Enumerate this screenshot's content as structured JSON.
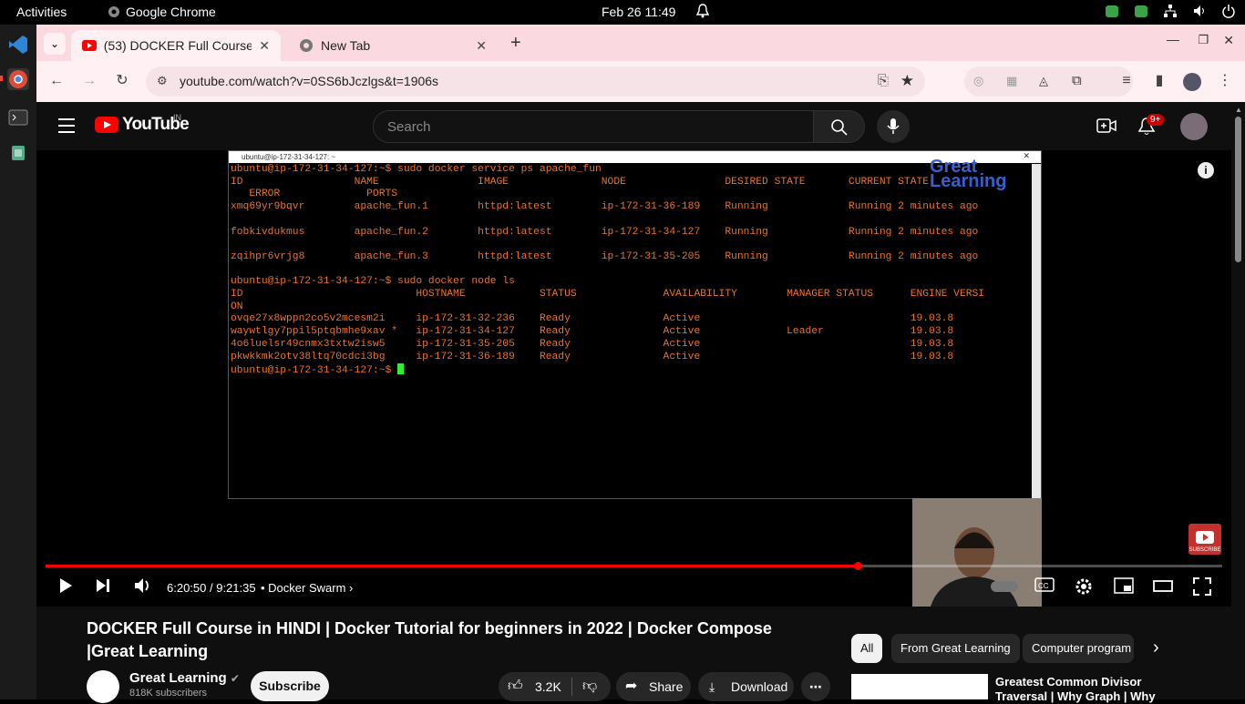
{
  "os": {
    "activities": "Activities",
    "app_name": "Google Chrome",
    "clock": "Feb 26  11:49"
  },
  "browser": {
    "tabs": [
      {
        "label": "(53) DOCKER Full Course",
        "active": true
      },
      {
        "label": "New Tab",
        "active": false
      }
    ],
    "url": "youtube.com/watch?v=0SS6bJczlgs&t=1906s"
  },
  "youtube": {
    "logo_text": "YouTube",
    "region": "IN",
    "search_placeholder": "Search",
    "notif_count": "9+"
  },
  "terminal": {
    "title": "ubuntu@ip-172-31-34-127: ~",
    "lines": [
      "ubuntu@ip-172-31-34-127:~$ sudo docker service ps apache_fun",
      "ID                  NAME                IMAGE               NODE                DESIRED STATE       CURRENT STATE",
      "   ERROR              PORTS",
      "xmq69yr9bqvr        apache_fun.1        httpd:latest        ip-172-31-36-189    Running             Running 2 minutes ago",
      "",
      "fobkivdukmus        apache_fun.2        httpd:latest        ip-172-31-34-127    Running             Running 2 minutes ago",
      "",
      "zqihpr6vrjg8        apache_fun.3        httpd:latest        ip-172-31-35-205    Running             Running 2 minutes ago",
      "",
      "ubuntu@ip-172-31-34-127:~$ sudo docker node ls",
      "ID                            HOSTNAME            STATUS              AVAILABILITY        MANAGER STATUS      ENGINE VERSI",
      "ON",
      "ovqe27x8wppn2co5v2mcesm2i     ip-172-31-32-236    Ready               Active                                  19.03.8",
      "waywtlgy7ppil5ptqbmhe9xav *   ip-172-31-34-127    Ready               Active              Leader              19.03.8",
      "4o6luelsr49cnmx3txtw2isw5     ip-172-31-35-205    Ready               Active                                  19.03.8",
      "pkwkkmk2otv38ltq70cdci3bg     ip-172-31-36-189    Ready               Active                                  19.03.8"
    ],
    "prompt": "ubuntu@ip-172-31-34-127:~$ "
  },
  "watermark": {
    "line1": "Great",
    "line2": "Learning",
    "subscribe": "SUBSCRIBE"
  },
  "player": {
    "time": "6:20:50 / 9:21:35",
    "chapter": "• Docker Swarm",
    "progress": 0.69
  },
  "video": {
    "title": "DOCKER Full Course in HINDI | Docker Tutorial for beginners in 2022 | Docker Compose |Great Learning",
    "channel": "Great Learning",
    "subscribers": "818K subscribers",
    "subscribe_label": "Subscribe",
    "likes": "3.2K",
    "share_label": "Share",
    "download_label": "Download"
  },
  "chips": [
    "All",
    "From Great Learning",
    "Computer program"
  ],
  "recommendation": {
    "title": "Greatest Common Divisor Traversal | Why Graph | Why"
  }
}
